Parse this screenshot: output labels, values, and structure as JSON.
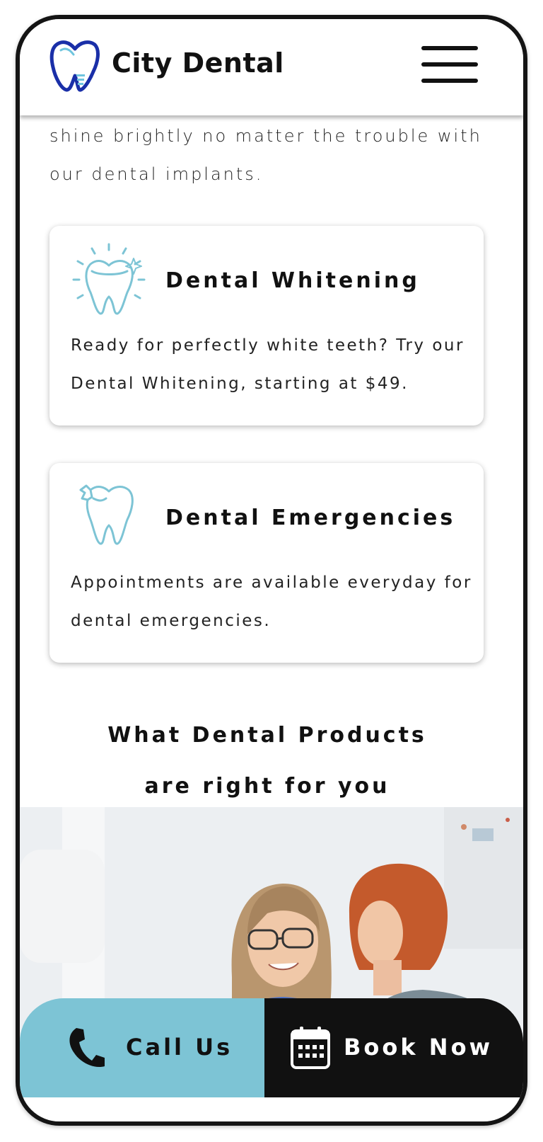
{
  "header": {
    "brand": "City Dental"
  },
  "intro": {
    "text": "shine brightly no matter the trouble with our dental implants."
  },
  "services": [
    {
      "title": "Dental Whitening",
      "description": "Ready for perfectly white teeth? Try our Dental Whitening, starting at $49."
    },
    {
      "title": "Dental Emergencies",
      "description": "Appointments are available everyday for dental emergencies."
    }
  ],
  "products": {
    "heading_line1": "What Dental Products",
    "heading_line2": "are right for you"
  },
  "cta": {
    "call_label": "Call Us",
    "book_label": "Book Now"
  },
  "colors": {
    "accent": "#7dc4d5",
    "dark": "#111111",
    "logo_blue": "#1a2fa8"
  },
  "icons": {
    "logo": "tooth-logo-icon",
    "menu": "hamburger-menu-icon",
    "whitening": "sparkling-tooth-icon",
    "emergency": "cracked-tooth-icon",
    "call": "phone-icon",
    "book": "calendar-icon"
  }
}
